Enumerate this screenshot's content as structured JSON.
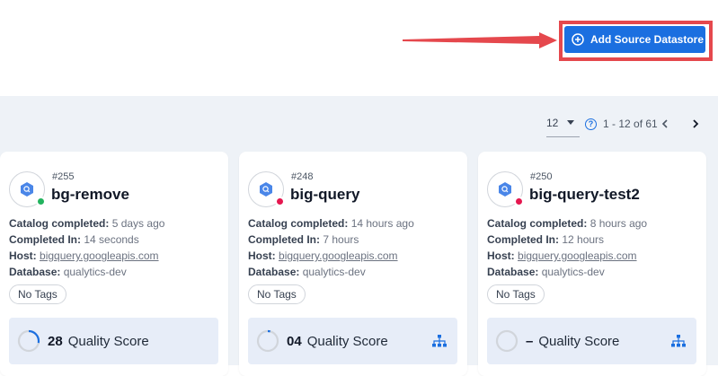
{
  "header": {
    "add_button_label": "Add Source Datastore"
  },
  "pagination": {
    "per_page": "12",
    "range": "1 - 12 of 61",
    "help_glyph": "?"
  },
  "colors": {
    "accent": "#1b6fe0",
    "highlight": "#e5484d",
    "status_green": "#22b35e",
    "status_red": "#e5174f"
  },
  "cards": [
    {
      "id": "#255",
      "name": "bg-remove",
      "status_color": "#22b35e",
      "catalog_label": "Catalog completed:",
      "catalog_value": "5 days ago",
      "completed_label": "Completed In:",
      "completed_value": "14 seconds",
      "host_label": "Host:",
      "host_value": "bigquery.googleapis.com",
      "db_label": "Database:",
      "db_value": "qualytics-dev",
      "tag": "No Tags",
      "score": "28",
      "score_label": "Quality Score",
      "score_pct": 28
    },
    {
      "id": "#248",
      "name": "big-query",
      "status_color": "#e5174f",
      "catalog_label": "Catalog completed:",
      "catalog_value": "14 hours ago",
      "completed_label": "Completed In:",
      "completed_value": "7 hours",
      "host_label": "Host:",
      "host_value": "bigquery.googleapis.com",
      "db_label": "Database:",
      "db_value": "qualytics-dev",
      "tag": "No Tags",
      "score": "04",
      "score_label": "Quality Score",
      "score_pct": 4
    },
    {
      "id": "#250",
      "name": "big-query-test2",
      "status_color": "#e5174f",
      "catalog_label": "Catalog completed:",
      "catalog_value": "8 hours ago",
      "completed_label": "Completed In:",
      "completed_value": "12 hours",
      "host_label": "Host:",
      "host_value": "bigquery.googleapis.com",
      "db_label": "Database:",
      "db_value": "qualytics-dev",
      "tag": "No Tags",
      "score": "–",
      "score_label": "Quality Score",
      "score_pct": 0
    }
  ]
}
